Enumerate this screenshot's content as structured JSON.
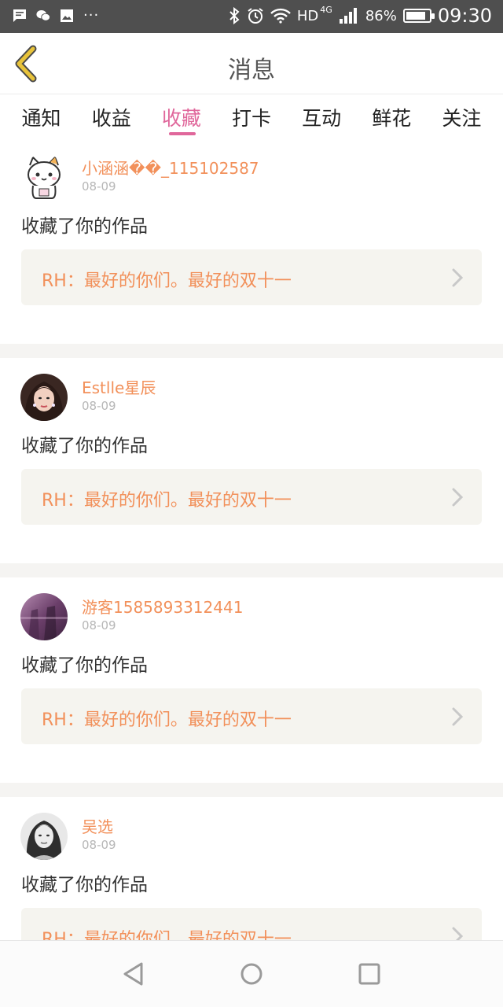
{
  "status_bar": {
    "left_icons": [
      "message-icon",
      "wechat-icon",
      "image-icon",
      "more-icon"
    ],
    "more_text": "···",
    "network": "HD",
    "network_type": "4G",
    "battery": "86%",
    "battery_level": 0.86,
    "time": "09:30"
  },
  "header": {
    "title": "消息",
    "back_icon": "back-chevron-icon",
    "accent": "#e8c33a"
  },
  "tabs": [
    {
      "label": "通知"
    },
    {
      "label": "收益"
    },
    {
      "label": "收藏",
      "active": true
    },
    {
      "label": "打卡"
    },
    {
      "label": "互动"
    },
    {
      "label": "鲜花"
    },
    {
      "label": "关注"
    }
  ],
  "colors": {
    "active_tab": "#e0679b",
    "username": "#f2905a",
    "work_title": "#f2905a",
    "card_bg": "#f5f4ef"
  },
  "feed": [
    {
      "user": "小涵涵��_115102587",
      "date": "08-09",
      "action": "收藏了你的作品",
      "work": "RH：最好的你们。最好的双十一",
      "avatar": "cat-avatar"
    },
    {
      "user": "Estlle星辰",
      "date": "08-09",
      "action": "收藏了你的作品",
      "work": "RH：最好的你们。最好的双十一",
      "avatar": "woman-avatar"
    },
    {
      "user": "游客1585893312441",
      "date": "08-09",
      "action": "收藏了你的作品",
      "work": "RH：最好的你们。最好的双十一",
      "avatar": "purple-photo-avatar"
    },
    {
      "user": "吴选",
      "date": "08-09",
      "action": "收藏了你的作品",
      "work": "RH：最好的你们。最好的双十一",
      "avatar": "portrait-avatar"
    }
  ],
  "nav": {
    "back": "nav-back-icon",
    "home": "nav-home-icon",
    "recents": "nav-recents-icon"
  }
}
